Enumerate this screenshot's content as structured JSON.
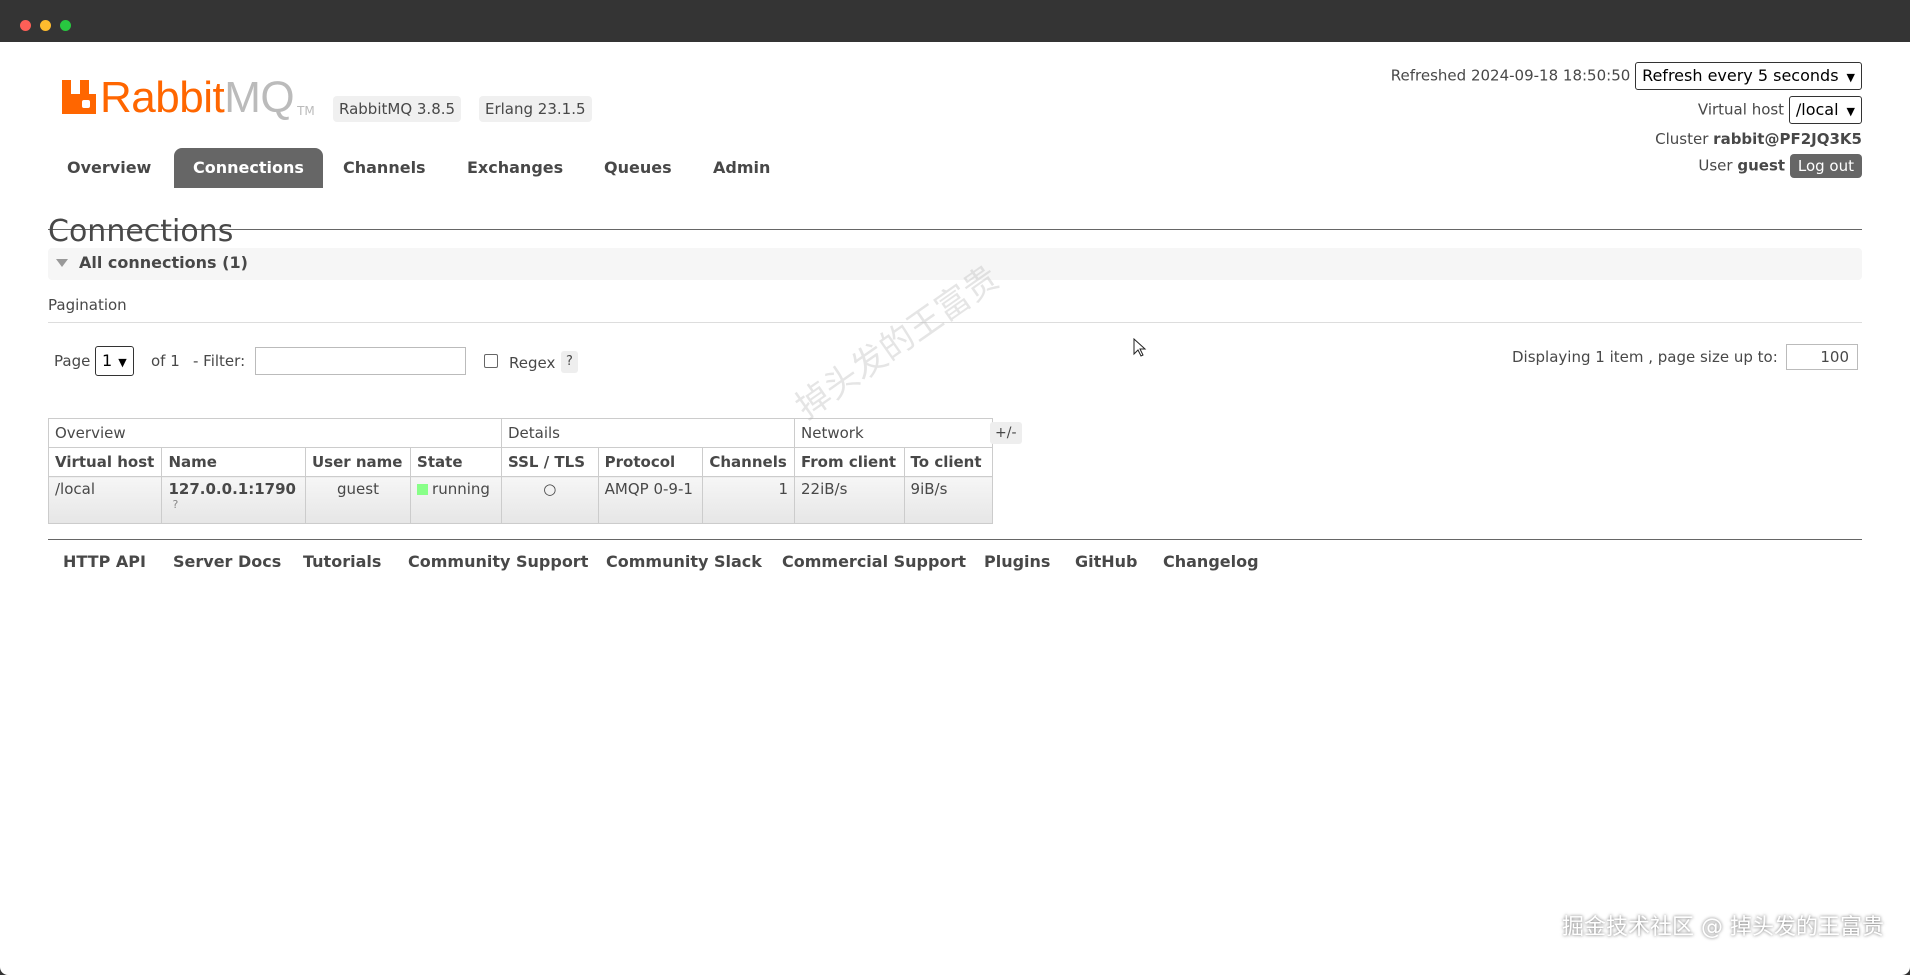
{
  "window": {
    "controls": [
      "close",
      "minimize",
      "maximize"
    ]
  },
  "logo": {
    "rabbit": "Rabbit",
    "mq": "MQ",
    "tm": "TM"
  },
  "versions": {
    "rabbitmq": "RabbitMQ 3.8.5",
    "erlang": "Erlang 23.1.5"
  },
  "header": {
    "refreshed_label": "Refreshed",
    "refreshed_time": "2024-09-18 18:50:50",
    "refresh_select": "Refresh every 5 seconds",
    "vhost_label": "Virtual host",
    "vhost_select": "/local",
    "cluster_label": "Cluster",
    "cluster_name": "rabbit@PF2JQ3K5",
    "user_label": "User",
    "user_name": "guest",
    "logout_label": "Log out"
  },
  "tabs": [
    {
      "label": "Overview",
      "active": false
    },
    {
      "label": "Connections",
      "active": true
    },
    {
      "label": "Channels",
      "active": false
    },
    {
      "label": "Exchanges",
      "active": false
    },
    {
      "label": "Queues",
      "active": false
    },
    {
      "label": "Admin",
      "active": false
    }
  ],
  "page_title": "Connections",
  "section": {
    "label": "All connections (1)"
  },
  "pagination": {
    "title": "Pagination",
    "page_label": "Page",
    "page_value": "1",
    "of_label": "of 1",
    "filter_label": "- Filter:",
    "filter_value": "",
    "regex_label": "Regex",
    "regex_checked": false,
    "help": "?",
    "displaying": "Displaying 1 item , page size up to:",
    "page_size": "100"
  },
  "table": {
    "groups": [
      "Overview",
      "Details",
      "Network"
    ],
    "toggle": "+/-",
    "headers": [
      "Virtual host",
      "Name",
      "User name",
      "State",
      "SSL / TLS",
      "Protocol",
      "Channels",
      "From client",
      "To client"
    ],
    "rows": [
      {
        "vhost": "/local",
        "name": "127.0.0.1:1790",
        "name_sub": "?",
        "user": "guest",
        "state": "running",
        "ssl": "○",
        "protocol": "AMQP 0-9-1",
        "channels": "1",
        "from_client": "22iB/s",
        "to_client": "9iB/s"
      }
    ]
  },
  "footer": {
    "links": [
      "HTTP API",
      "Server Docs",
      "Tutorials",
      "Community Support",
      "Community Slack",
      "Commercial Support",
      "Plugins",
      "GitHub",
      "Changelog"
    ]
  },
  "watermark": "掉头发的王富贵",
  "credit": "掘金技术社区 @ 掉头发的王富贵",
  "colors": {
    "accent": "#ff6600",
    "tab_active": "#666666",
    "running": "#88ff88"
  }
}
